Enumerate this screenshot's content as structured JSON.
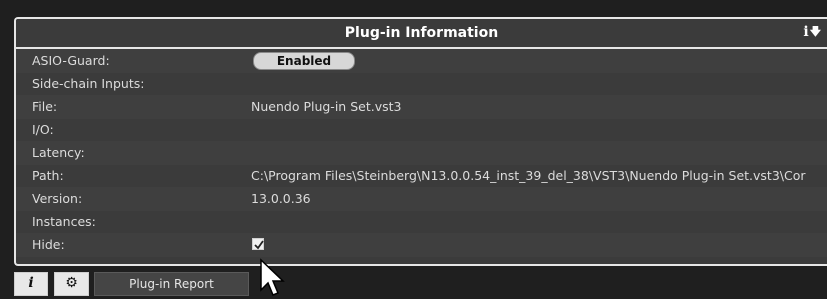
{
  "panel": {
    "title": "Plug-in Information",
    "info_icon": "i",
    "rows": [
      {
        "label": "ASIO-Guard:",
        "value": "",
        "widget": "button",
        "button_label": "Enabled"
      },
      {
        "label": "Side-chain Inputs:",
        "value": ""
      },
      {
        "label": "File:",
        "value": "Nuendo Plug-in Set.vst3"
      },
      {
        "label": "I/O:",
        "value": ""
      },
      {
        "label": "Latency:",
        "value": ""
      },
      {
        "label": "Path:",
        "value": "C:\\Program Files\\Steinberg\\N13.0.0.54_inst_39_del_38\\VST3\\Nuendo Plug-in Set.vst3\\Cor"
      },
      {
        "label": "Version:",
        "value": "13.0.0.36"
      },
      {
        "label": "Instances:",
        "value": ""
      },
      {
        "label": "Hide:",
        "value": "",
        "widget": "checkbox",
        "checked": true
      }
    ]
  },
  "footer": {
    "info_button_icon": "info-icon",
    "settings_button_icon": "gear-icon",
    "report_label": "Plug-in Report"
  }
}
